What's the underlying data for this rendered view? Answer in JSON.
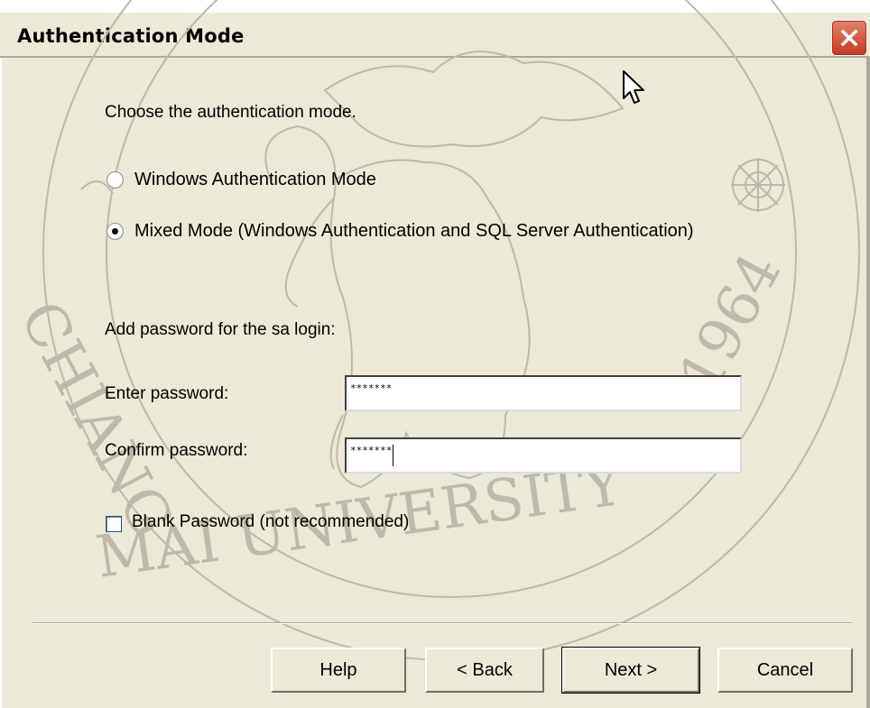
{
  "window": {
    "title": "Authentication Mode"
  },
  "prompt": "Choose the authentication mode.",
  "auth_modes": [
    {
      "label": "Windows Authentication Mode",
      "selected": false
    },
    {
      "label": "Mixed Mode (Windows Authentication and SQL Server Authentication)",
      "selected": true
    }
  ],
  "sa_section": {
    "heading": "Add password for the sa login:",
    "enter_label": "Enter password:",
    "enter_value": "*******",
    "confirm_label": "Confirm password:",
    "confirm_value": "*******"
  },
  "blank_password": {
    "label": "Blank Password (not recommended)",
    "checked": false
  },
  "buttons": {
    "help": "Help",
    "back": "< Back",
    "next": "Next >",
    "cancel": "Cancel"
  },
  "watermark": {
    "text_left": "CHIANG",
    "text_bottom": "MAI UNIVERSITY",
    "year": "1964"
  },
  "colors": {
    "dialog_bg": "#ece9d8",
    "close_button": "#c43a1c",
    "watermark": "#b9b6a8"
  }
}
